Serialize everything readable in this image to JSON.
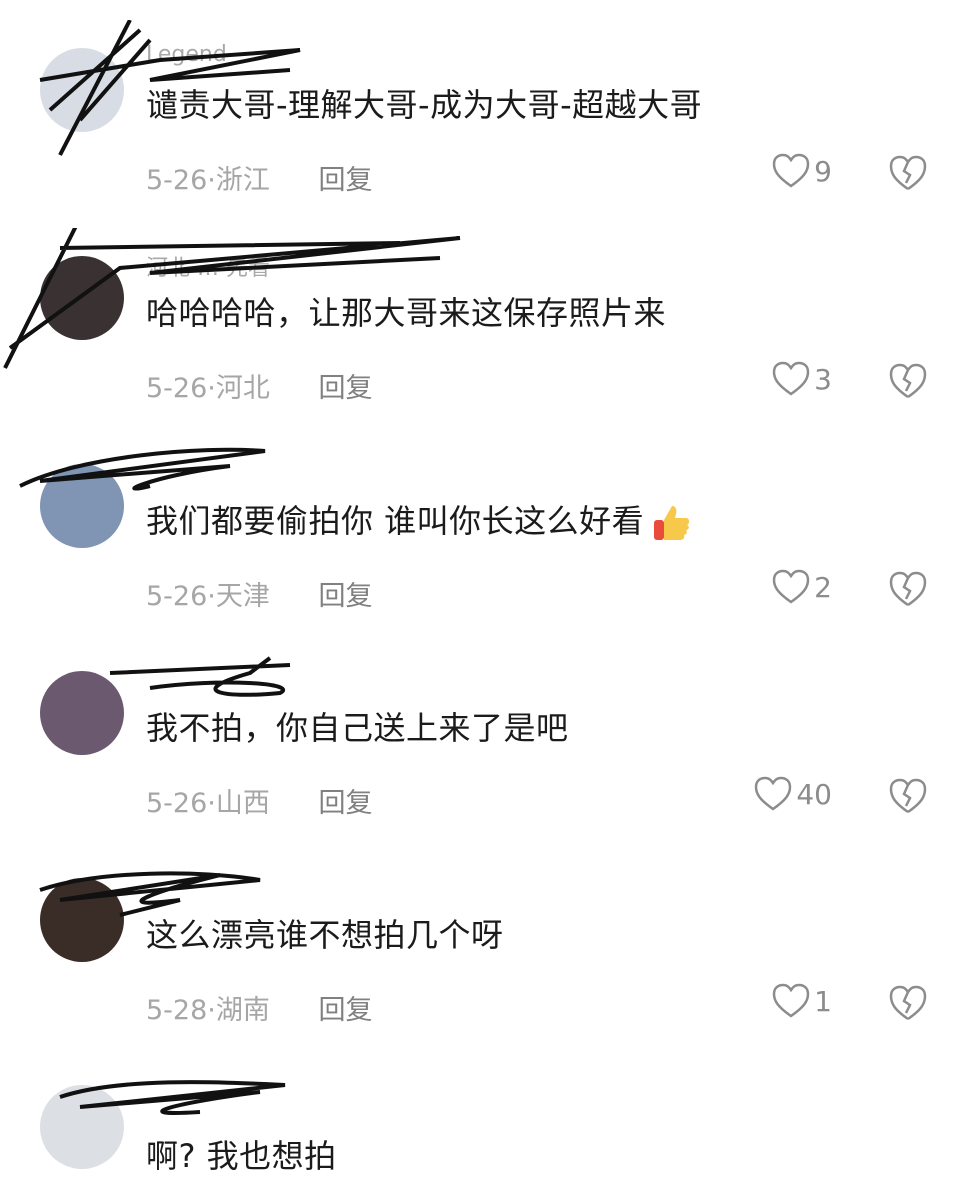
{
  "comments": [
    {
      "username": "Legend",
      "text": "谴责大哥-理解大哥-成为大哥-超越大哥",
      "date": "5-26·浙江",
      "reply": "回复",
      "likes": "9",
      "avatar_color": "#d8dde5"
    },
    {
      "username": "河北 … 先看",
      "text": "哈哈哈哈，让那大哥来这保存照片来",
      "date": "5-26·河北",
      "reply": "回复",
      "likes": "3",
      "avatar_color": "#3a3232"
    },
    {
      "username": "",
      "text": "我们都要偷拍你 谁叫你长这么好看",
      "date": "5-26·天津",
      "reply": "回复",
      "likes": "2",
      "avatar_color": "#7f95b3"
    },
    {
      "username": "",
      "text": "我不拍，你自己送上来了是吧",
      "date": "5-26·山西",
      "reply": "回复",
      "likes": "40",
      "avatar_color": "#6b5a6f"
    },
    {
      "username": "",
      "text": "这么漂亮谁不想拍几个呀",
      "date": "5-28·湖南",
      "reply": "回复",
      "likes": "1",
      "avatar_color": "#3a2d28"
    },
    {
      "username": "",
      "text": "啊? 我也想拍",
      "date": "",
      "reply": "",
      "likes": "",
      "avatar_color": "#dcdfe4"
    }
  ],
  "colors": {
    "text": "#1b1b1b",
    "meta": "#a6a6a6",
    "icon": "#8c8c8c"
  },
  "icons": {
    "like": "heart-outline-icon",
    "dislike": "broken-heart-icon",
    "thumbs": "thumbs-up-emoji"
  }
}
